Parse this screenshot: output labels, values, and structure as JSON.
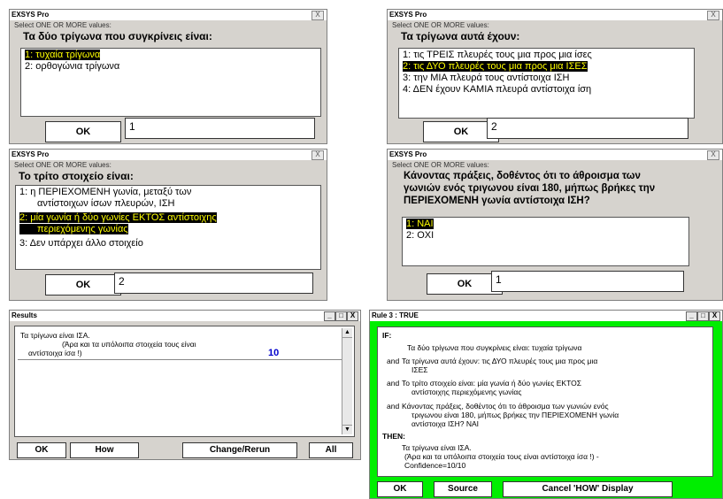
{
  "app_title": "EXSYS Pro",
  "instruction": "Select ONE OR MORE values:",
  "ok_label": "OK",
  "close_glyph": "X",
  "dlg1": {
    "question": "Τα δύο τρίγωνα που συγκρίνεις είναι:",
    "options": [
      "1: τυχαία τρίγωνα",
      "2: ορθογώνια τρίγωνα"
    ],
    "selected": 0,
    "input_value": "1"
  },
  "dlg2": {
    "question": "Τα τρίγωνα αυτά έχουν:",
    "options": [
      "1: τις ΤΡΕΙΣ πλευρές τους μια προς μια ίσες",
      "2: τις ΔΥΟ πλευρές τους μια προς μια ΙΣΕΣ",
      "3: την ΜΙΑ πλευρά τους αντίστοιχα ΙΣΗ",
      "4: ΔΕΝ έχουν ΚΑΜΙΑ πλευρά αντίστοιχα ίση"
    ],
    "selected": 1,
    "input_value": "2"
  },
  "dlg3": {
    "question": "Το τρίτο στοιχείο είναι:",
    "opt1_line1": "1: η ΠΕΡΙΕΧΟΜΕΝΗ γωνία, μεταξύ των",
    "opt1_line2": "αντίστοιχων ίσων πλευρών, ΙΣΗ",
    "opt2_line1": "2: μία γωνία ή δύο γωνίες ΕΚΤΟΣ αντίστοιχης",
    "opt2_line2": "περιεχόμενης γωνίας",
    "opt3": "3: Δεν υπάρχει άλλο στοιχείο",
    "input_value": "2"
  },
  "dlg4": {
    "question_lines": [
      "Κάνοντας πράξεις, δοθέντος ότι το άθροισμα των",
      "γωνιών ενός τριγωνου είναι 180, μήπως βρήκες την",
      "ΠΕΡΙΕΧΟΜΕΝΗ γωνία αντίστοιχα ΙΣΗ?"
    ],
    "options": [
      "1: ΝΑΙ",
      "2: ΟΧΙ"
    ],
    "selected": 0,
    "input_value": "1"
  },
  "results": {
    "title": "Results",
    "line1": "Τα τρίγωνα είναι ΙΣΑ.",
    "line2": "(Άρα και τα υπόλοιπα στοιχεία τους είναι",
    "line3": "αντίστοιχα ίσα !)",
    "confidence": "10",
    "buttons": {
      "ok": "OK",
      "how": "How",
      "change": "Change/Rerun",
      "all": "All"
    },
    "controls": {
      "min": "_",
      "max": "□",
      "close": "X"
    }
  },
  "rule": {
    "title": "Rule 3 : TRUE",
    "if_label": "IF:",
    "c1": "Τα δύο τρίγωνα που συγκρίνεις είναι: τυχαία τρίγωνα",
    "and_label": "and",
    "c2_line1": "Τα τρίγωνα αυτά έχουν: τις ΔΥΟ πλευρές τους μια προς μια",
    "c2_line2": "ΙΣΕΣ",
    "c3_line1": "Το τρίτο στοιχείο είναι: μία γωνία ή δύο γωνίες ΕΚΤΟΣ",
    "c3_line2": "αντίστοιχης περιεχόμενης γωνίας",
    "c4_line1": "Κάνοντας πράξεις, δοθέντος ότι το άθροισμα των γωνιών ενός",
    "c4_line2": "τριγωνου είναι 180, μήπως βρήκες την ΠΕΡΙΕΧΟΜΕΝΗ γωνία",
    "c4_line3": "αντίστοιχα ΙΣΗ? ΝΑΙ",
    "then_label": "THEN:",
    "t1": "Τα τρίγωνα είναι ΙΣΑ.",
    "t2": "(Άρα και τα υπόλοιπα στοιχεία τους είναι αντίστοιχα ίσα !) -",
    "t3": "Confidence=10/10",
    "buttons": {
      "ok": "OK",
      "source": "Source",
      "cancel": "Cancel 'HOW' Display"
    },
    "controls": {
      "min": "_",
      "max": "□",
      "close": "X"
    }
  },
  "colors": {
    "window_bg": "#d6d3ce",
    "selection_bg": "#000000",
    "selection_fg": "#ffff00",
    "rule_bg": "#00ee00",
    "confidence_color": "#0000cc"
  }
}
